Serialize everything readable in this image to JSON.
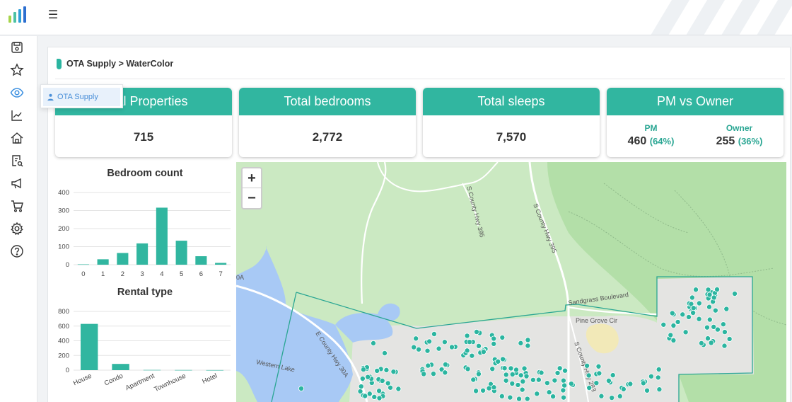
{
  "breadcrumb": {
    "text": "OTA Supply > WaterColor"
  },
  "flyout": {
    "label": "OTA Supply"
  },
  "kpis": [
    {
      "title": "Total Properties",
      "value": "715"
    },
    {
      "title": "Total bedrooms",
      "value": "2,772"
    },
    {
      "title": "Total sleeps",
      "value": "7,570"
    },
    {
      "title": "PM vs Owner",
      "pm_label": "PM",
      "pm_value": "460",
      "pm_pct": "(64%)",
      "owner_label": "Owner",
      "owner_value": "255",
      "owner_pct": "(36%)"
    }
  ],
  "icons": {
    "sidebar": [
      "save-icon",
      "star-icon",
      "eye-icon",
      "chart-line-icon",
      "home-icon",
      "report-search-icon",
      "megaphone-icon",
      "cart-icon",
      "gear-icon",
      "help-icon"
    ]
  },
  "colors": {
    "accent": "#31b6a0",
    "accent_text": "#2aa693",
    "link": "#4a8fd8"
  },
  "map": {
    "zoom_in": "+",
    "zoom_out": "−",
    "labels": {
      "lake": "Western Lake",
      "hwy395_north": "S County Hwy 395",
      "hwy395_south": "S County Hwy 395",
      "hwy30a": "E County Hwy 30A",
      "hwy283": "S County Hwy 283",
      "blvd": "Sandgrass Boulevard",
      "pinegrove": "Pine Grove Cir",
      "edge_30a": "0A"
    }
  },
  "chart_data": [
    {
      "type": "bar",
      "title": "Bedroom count",
      "categories": [
        "0",
        "1",
        "2",
        "3",
        "4",
        "5",
        "6",
        "7"
      ],
      "values": [
        2,
        30,
        65,
        118,
        316,
        133,
        47,
        10
      ],
      "ylim": [
        0,
        400
      ],
      "yticks": [
        "0",
        "100",
        "200",
        "300",
        "400"
      ],
      "grid": true
    },
    {
      "type": "bar",
      "title": "Rental type",
      "categories": [
        "House",
        "Condo",
        "Apartment",
        "Townhouse",
        "Hotel"
      ],
      "values": [
        630,
        85,
        3,
        2,
        1
      ],
      "ylim": [
        0,
        800
      ],
      "yticks": [
        "0",
        "200",
        "400",
        "600",
        "800"
      ],
      "grid": true
    }
  ]
}
